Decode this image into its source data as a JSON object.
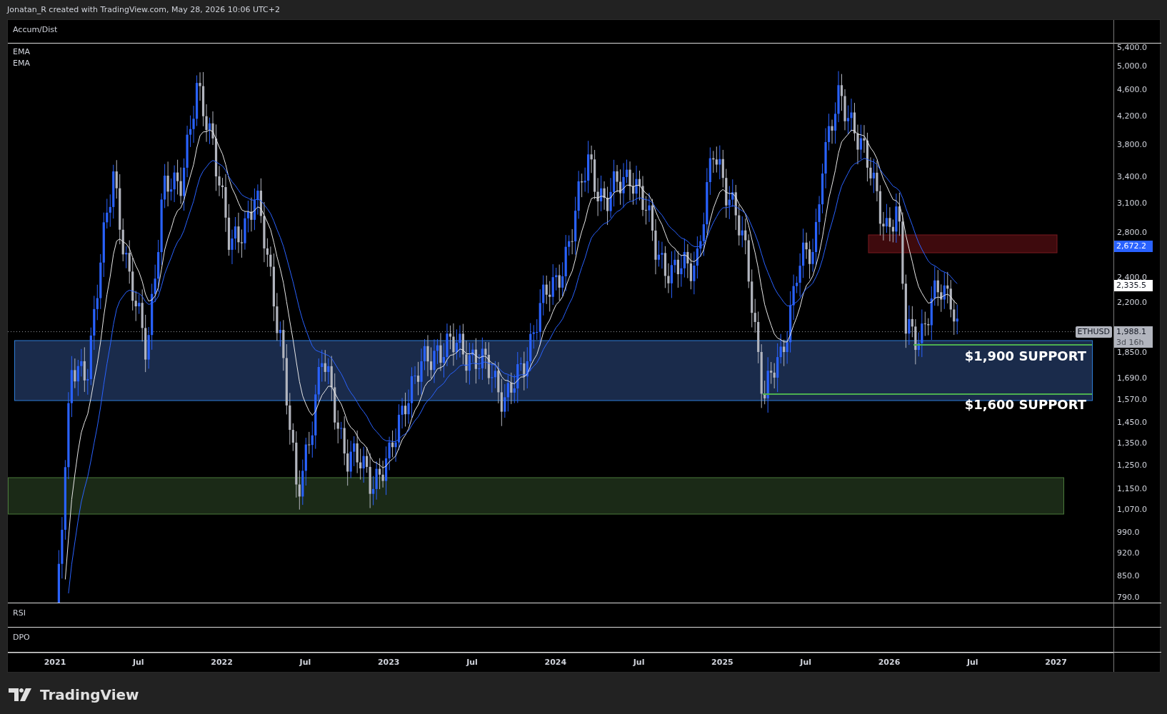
{
  "header": {
    "text": "Jonatan_R created with TradingView.com, May 28, 2026 10:06 UTC+2"
  },
  "accum_pane": {
    "legend": "Accum/Dist"
  },
  "main_pane": {
    "legend": [
      "EMA",
      "EMA"
    ],
    "symbol_tag": "ETHUSD",
    "annotations": [
      {
        "text": "$1,900 SUPPORT"
      },
      {
        "text": "$1,600 SUPPORT"
      }
    ],
    "price_axis": {
      "labels": [
        "5,400.0",
        "5,000.0",
        "4,600.0",
        "4,200.0",
        "3,800.0",
        "3,400.0",
        "3,100.0",
        "2,800.0",
        "2,400.0",
        "2,200.0",
        "1,850.0",
        "1,690.0",
        "1,570.0",
        "1,450.0",
        "1,350.0",
        "1,250.0",
        "1,150.0",
        "1,070.0",
        "990.0",
        "920.0",
        "850.0",
        "790.0"
      ],
      "badges": [
        {
          "text": "2,672.2",
          "color": "#2962ff"
        },
        {
          "text": "2,335.5",
          "color": "#ffffff"
        },
        {
          "text": "1,988.1",
          "countdown": "3d 16h",
          "color": "#b2b5be"
        }
      ]
    }
  },
  "rsi_pane": {
    "legend": "RSI"
  },
  "dpo_pane": {
    "legend": "DPO"
  },
  "time_axis": {
    "labels": [
      "2021",
      "Jul",
      "2022",
      "Jul",
      "2023",
      "Jul",
      "2024",
      "Jul",
      "2025",
      "Jul",
      "2026",
      "Jul",
      "2027"
    ]
  },
  "footer": {
    "brand": "TradingView"
  }
}
